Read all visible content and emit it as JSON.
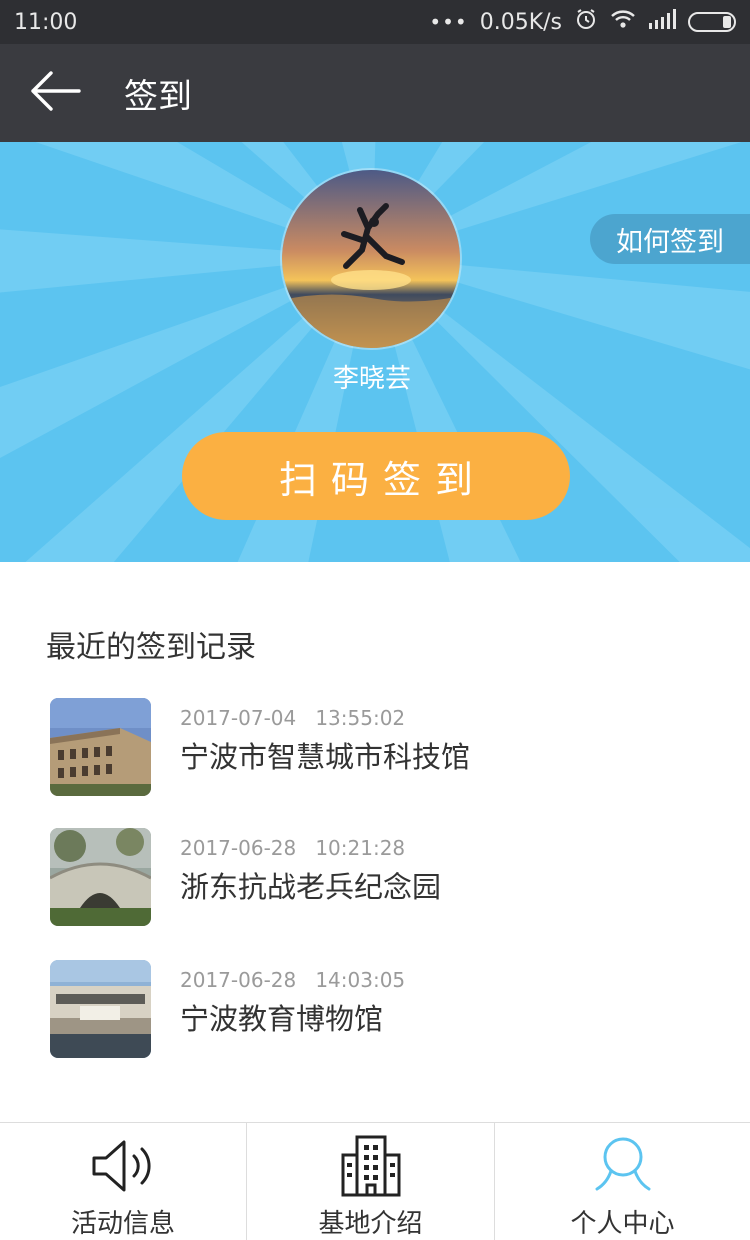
{
  "status_bar": {
    "time": "11:00",
    "dots": "•••",
    "network_speed": "0.05K/s",
    "icons": [
      "alarm-icon",
      "wifi-icon",
      "signal-icon",
      "battery-icon"
    ]
  },
  "app_bar": {
    "title": "签到",
    "back_icon": "arrow-left-icon"
  },
  "hero": {
    "background_color": "#5cc4f0",
    "username": "李晓芸",
    "how_to_label": "如何签到",
    "scan_button_label": "扫码签到",
    "scan_button_color": "#fbb042"
  },
  "records": {
    "title": "最近的签到记录",
    "items": [
      {
        "date": "2017-07-04",
        "time": "13:55:02",
        "name": "宁波市智慧城市科技馆"
      },
      {
        "date": "2017-06-28",
        "time": "10:21:28",
        "name": "浙东抗战老兵纪念园"
      },
      {
        "date": "2017-06-28",
        "time": "14:03:05",
        "name": "宁波教育博物馆"
      }
    ]
  },
  "bottom_nav": {
    "items": [
      {
        "label": "活动信息",
        "icon": "speaker-icon",
        "active": false
      },
      {
        "label": "基地介绍",
        "icon": "building-icon",
        "active": false
      },
      {
        "label": "个人中心",
        "icon": "person-icon",
        "active": true
      }
    ],
    "active_color": "#5cc4f0"
  }
}
